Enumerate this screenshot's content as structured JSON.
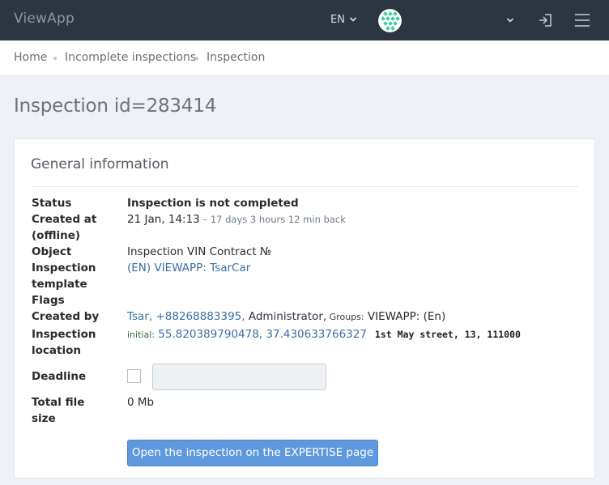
{
  "topbar": {
    "brand": "ViewApp",
    "language": "EN",
    "icons": [
      "chevron-down-icon",
      "avatar",
      "logout-icon",
      "hamburger-menu-icon"
    ]
  },
  "breadcrumb": [
    "Home",
    "Incomplete inspections",
    "Inspection"
  ],
  "page": {
    "title": "Inspection id=283414"
  },
  "card": {
    "title": "General information",
    "status_label": "Status",
    "status_value": "Inspection is not completed",
    "created_label": "Created at (offline)",
    "created_date": "21 Jan, 14:13",
    "created_ago": " – 17 days 3 hours 12 min back",
    "object_label": "Object",
    "object_value": "Inspection VIN Contract №",
    "template_label": "Inspection template",
    "template_value": "(EN) VIEWAPP: TsarCar",
    "flags_label": "Flags",
    "createdby_label": "Created by",
    "createdby_user": "Tsar, +88268883395,",
    "createdby_role": " Administrator,",
    "createdby_groups_label": " Groups:",
    "createdby_groups": " VIEWAPP: (En)",
    "location_label": "Inspection location",
    "location_initial": "initial:",
    "location_coords": " 55.820389790478, 37.430633766327",
    "location_address": "1st May street, 13, 111000",
    "deadline_label": "Deadline",
    "filesize_label": "Total file size",
    "filesize_value": "0 Mb",
    "open_button": "Open the inspection on the EXPERTISE page"
  },
  "colors": {
    "topbar": "#2d3540",
    "accent": "#5e98dd",
    "link": "#3a6ea5"
  }
}
